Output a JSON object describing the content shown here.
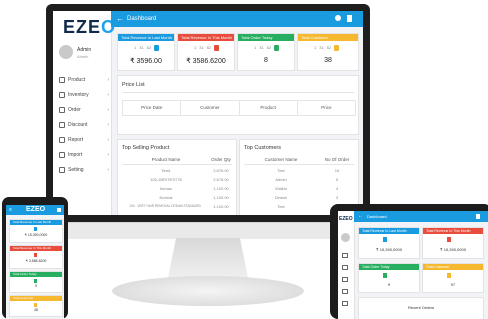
{
  "brand": {
    "logo_prefix": "EZE",
    "logo_suffix": "O",
    "accent": "#1a9be0"
  },
  "user": {
    "name": "Admin",
    "role": "Admin"
  },
  "topbar": {
    "title": "Dashboard"
  },
  "sidebar": {
    "items": [
      {
        "label": "Product",
        "icon": "box-icon"
      },
      {
        "label": "Inventory",
        "icon": "boxes-icon"
      },
      {
        "label": "Order",
        "icon": "cart-icon"
      },
      {
        "label": "Discount",
        "icon": "tag-icon"
      },
      {
        "label": "Report",
        "icon": "chart-icon"
      },
      {
        "label": "Import",
        "icon": "import-icon"
      },
      {
        "label": "Setting",
        "icon": "gear-icon"
      }
    ]
  },
  "cards": [
    {
      "title": "Total Revenue In Last Month",
      "value": "₹ 3596.00",
      "color": "#1a9be0",
      "mini": [
        "1",
        "31",
        "62"
      ]
    },
    {
      "title": "Total Revenue In This Month",
      "value": "₹ 3586.6200",
      "color": "#e74c3c",
      "mini": [
        "1",
        "31",
        "62"
      ]
    },
    {
      "title": "Total Order Today",
      "value": "8",
      "color": "#27ae60",
      "mini": [
        "1",
        "31",
        "62"
      ]
    },
    {
      "title": "Total Customer",
      "value": "38",
      "color": "#f5b82e",
      "mini": [
        "1",
        "31",
        "62"
      ]
    }
  ],
  "pricelist": {
    "title": "Price List",
    "headers": [
      "Price Date",
      "Customer",
      "Product",
      "Price"
    ]
  },
  "top_products": {
    "title": "Top Selling Product",
    "headers": [
      "Product Name",
      "Order Qty"
    ],
    "rows": [
      [
        "Test1",
        "2,676.00"
      ],
      [
        "100-1BRITEST78",
        "2,678.00"
      ],
      [
        "Ilumas",
        "1,100.00"
      ],
      [
        "Normal",
        "1,100.00"
      ],
      [
        "100 - VEET HAIR REMOVAL CREAM STANDARD",
        "1,100.00"
      ]
    ]
  },
  "top_customers": {
    "title": "Top Customers",
    "headers": [
      "Customer Name",
      "No Of Order"
    ],
    "rows": [
      [
        "Test",
        "15"
      ],
      [
        "Admin",
        "5"
      ],
      [
        "Walkin",
        "4"
      ],
      [
        "Dinesh",
        "3"
      ],
      [
        "Test",
        "3"
      ]
    ]
  },
  "tablet": {
    "logo": "EZEO",
    "title": "Dashboard",
    "cards": [
      {
        "title": "Total Revenue In Last Month",
        "value": "₹ 15,390,0000",
        "color": "#1a9be0"
      },
      {
        "title": "Total Revenue In This Month",
        "value": "₹ 15,390,0000",
        "color": "#e74c3c"
      },
      {
        "title": "Total Order Today",
        "value": "9",
        "color": "#27ae60"
      },
      {
        "title": "Total Customer",
        "value": "97",
        "color": "#f5b82e"
      }
    ],
    "recent": "Recent Orders"
  },
  "phone": {
    "logo": "EZEO",
    "cards": [
      {
        "title": "Total Revenue In Last Month",
        "value": "₹ 15,390,0000",
        "color": "#1a9be0"
      },
      {
        "title": "Total Revenue In This Month",
        "value": "₹ 3,586.6200",
        "color": "#e74c3c"
      },
      {
        "title": "Total Order Today",
        "value": "9",
        "color": "#27ae60"
      },
      {
        "title": "Total Customer",
        "value": "48",
        "color": "#f5b82e"
      }
    ]
  }
}
